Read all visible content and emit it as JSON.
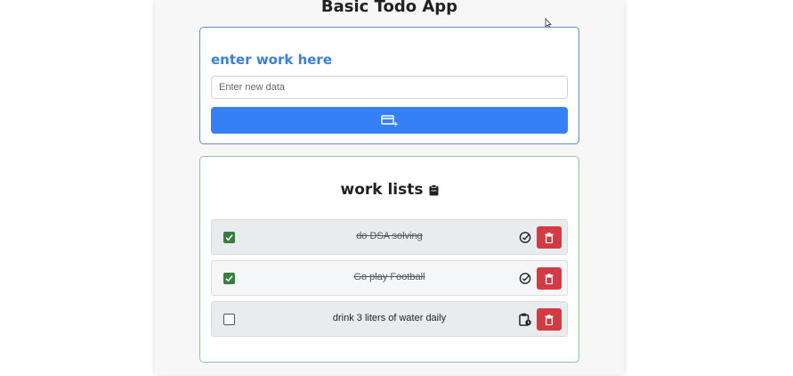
{
  "app": {
    "title": "Basic Todo App"
  },
  "entry": {
    "heading": "enter work here",
    "input_placeholder": "Enter new data",
    "input_value": "",
    "add_button_icon": "add-card-icon"
  },
  "list": {
    "heading": "work lists",
    "heading_icon": "clipboard-icon",
    "items": [
      {
        "text": "do DSA solving",
        "completed": true,
        "status_icon": "check-circle-icon"
      },
      {
        "text": "Go play Football",
        "completed": true,
        "status_icon": "check-circle-icon"
      },
      {
        "text": "drink 3 liters of water daily",
        "completed": false,
        "status_icon": "clipboard-clock-icon"
      }
    ]
  },
  "colors": {
    "accent_blue": "#3680f5",
    "heading_blue": "#3d7fd0",
    "delete_red": "#d23b44",
    "check_green": "#3a7d3f"
  }
}
